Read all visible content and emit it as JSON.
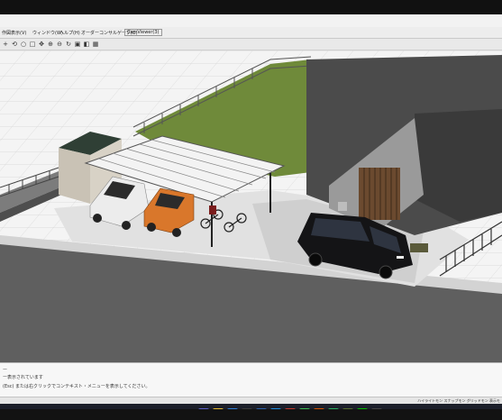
{
  "menubar": {
    "items": [
      "作図表示(V)",
      "ウィンドウ(W)",
      "ヘルプ(H)",
      "オーダーコンサルゲーブ(O)"
    ],
    "viewer_label": "CamViewer(3)"
  },
  "command_panel": {
    "line1": "ー",
    "line2": "ー表示されています",
    "line3": "(Esc) または右クリックでコンテキスト・メニューを表示してください。"
  },
  "status_bar": {
    "right_label": "ハイライトモン  スナップモン  グリッドモン  表示モ"
  },
  "toolbar_icons": [
    "plus-icon",
    "arrow-icon",
    "circle-icon",
    "square-icon",
    "zoom-in-icon",
    "zoom-out-icon",
    "rotate-icon",
    "pan-icon",
    "fit-icon",
    "view-icon"
  ],
  "taskbar_icons": [
    "windows-icon",
    "search-icon",
    "task-view-icon",
    "chat-icon",
    "folder-icon",
    "edge-icon",
    "store-icon",
    "app-icon",
    "app2-icon",
    "chrome-icon",
    "app3-icon",
    "app4-icon",
    "line-icon",
    "app5-icon"
  ],
  "colors": {
    "lawn": "#6f8a3a",
    "road": "#5e5e5e",
    "building": "#4a4a4a",
    "car_white": "#ececec",
    "car_orange": "#d9772b",
    "van_black": "#141416"
  }
}
